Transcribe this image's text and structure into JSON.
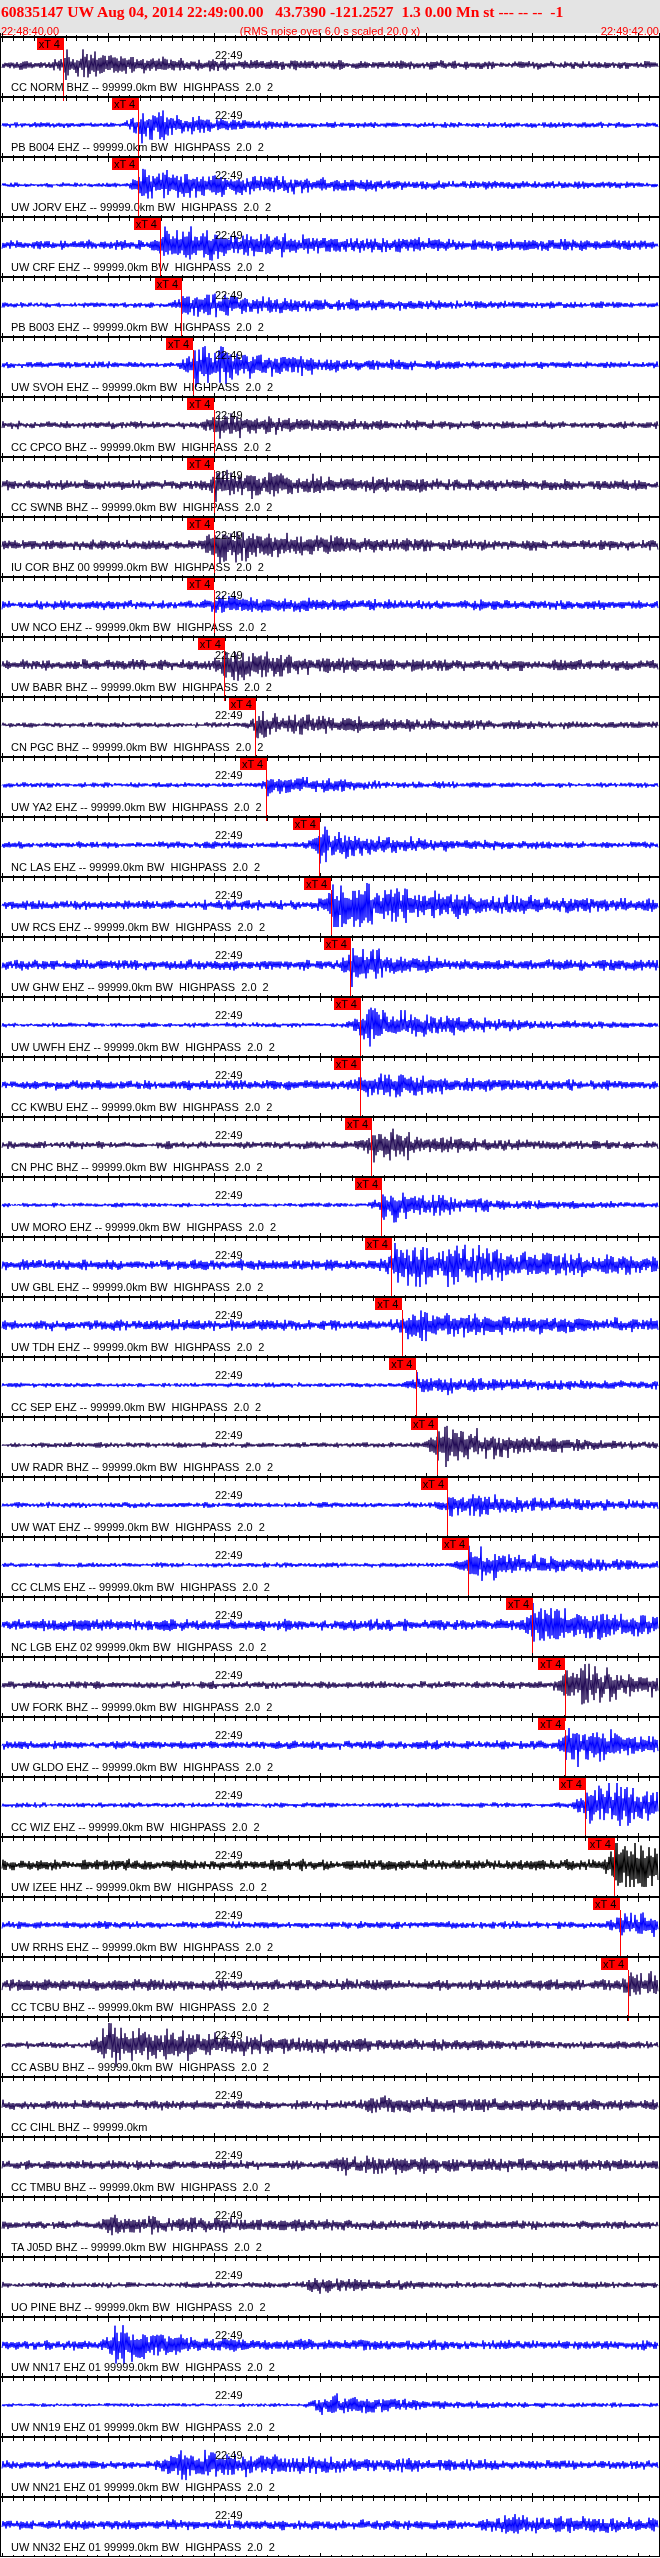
{
  "header": {
    "title": "60835147 UW Aug 04, 2014 22:49:00.00   43.7390 -121.2527  1.3 0.00 Mn st --- -- --  -1",
    "start_time": "22:48:40.00",
    "note": "(RMS noise over 6.0 s scaled 20.0 x)",
    "end_time": "22:49:42.00"
  },
  "traces": [
    {
      "label": "CC NORM BHZ -- 99999.0km BW  HIGHPASS  2.0  2",
      "time_label": "22:49",
      "color": "#220b55",
      "pick": {
        "label": "xT 4",
        "level": 0.095
      }
    },
    {
      "label": "PB B004 EHZ -- 99999.0km BW  HIGHPASS  2.0  2",
      "time_label": "22:49",
      "color": "#0000ff",
      "pick": {
        "label": "xT 4",
        "level": 0.209
      }
    },
    {
      "label": "UW JORV EHZ -- 99999.0km BW  HIGHPASS  2.0  2",
      "time_label": "22:49",
      "color": "#0000ff",
      "pick": {
        "label": "xT 4",
        "level": 0.209
      }
    },
    {
      "label": "UW CRF EHZ -- 99999.0km BW  HIGHPASS  2.0  2",
      "time_label": "22:49",
      "color": "#0000ff",
      "pick": {
        "label": "xT 4",
        "level": 0.242
      }
    },
    {
      "label": "PB B003 EHZ -- 99999.0km BW  HIGHPASS  2.0  2",
      "time_label": "22:49",
      "color": "#0000ff",
      "pick": {
        "label": "xT 4",
        "level": 0.274
      }
    },
    {
      "label": "UW SVOH EHZ -- 99999.0km BW  HIGHPASS  2.0  2",
      "time_label": "22:49",
      "color": "#0000ff",
      "pick": {
        "label": "xT 4",
        "level": 0.291
      }
    },
    {
      "label": "CC CPCO BHZ -- 99999.0km BW  HIGHPASS  2.0  2",
      "time_label": "22:49",
      "color": "#220b55",
      "pick": {
        "label": "xT 4",
        "level": 0.323
      }
    },
    {
      "label": "CC SWNB BHZ -- 99999.0km BW  HIGHPASS  2.0  2",
      "time_label": "22:49",
      "color": "#220b55",
      "pick": {
        "label": "xT 4",
        "level": 0.323
      }
    },
    {
      "label": "IU COR BHZ 00 99999.0km BW  HIGHPASS  2.0  2",
      "time_label": "22:49",
      "color": "#220b55",
      "pick": {
        "label": "xT 4",
        "level": 0.323
      }
    },
    {
      "label": "UW NCO EHZ -- 99999.0km BW  HIGHPASS  2.0  2",
      "time_label": "22:49",
      "color": "#0000ff",
      "pick": {
        "label": "xT 4",
        "level": 0.323
      }
    },
    {
      "label": "UW BABR BHZ -- 99999.0km BW  HIGHPASS  2.0  2",
      "time_label": "22:49",
      "color": "#220b55",
      "pick": {
        "label": "xT 4",
        "level": 0.339
      }
    },
    {
      "label": "CN PGC BHZ -- 99999.0km BW  HIGHPASS  2.0  2",
      "time_label": "22:49",
      "color": "#220b55",
      "pick": {
        "label": "xT 4",
        "level": 0.386
      }
    },
    {
      "label": "UW YA2 EHZ -- 99999.0km BW  HIGHPASS  2.0  2",
      "time_label": "22:49",
      "color": "#0000ff",
      "pick": {
        "label": "xT 4",
        "level": 0.403
      }
    },
    {
      "label": "NC LAS EHZ -- 99999.0km BW  HIGHPASS  2.0  2",
      "time_label": "22:49",
      "color": "#0000ff",
      "pick": {
        "label": "xT 4",
        "level": 0.483
      }
    },
    {
      "label": "UW RCS EHZ -- 99999.0km BW  HIGHPASS  2.0  2",
      "time_label": "22:49",
      "color": "#0000ff",
      "pick": {
        "label": "xT 4",
        "level": 0.5
      }
    },
    {
      "label": "UW GHW EHZ -- 99999.0km BW  HIGHPASS  2.0  2",
      "time_label": "22:49",
      "color": "#0000ff",
      "pick": {
        "label": "xT 4",
        "level": 0.53
      }
    },
    {
      "label": "UW UWFH EHZ -- 99999.0km BW  HIGHPASS  2.0  2",
      "time_label": "22:49",
      "color": "#0000ff",
      "pick": {
        "label": "xT 4",
        "level": 0.545
      }
    },
    {
      "label": "CC KWBU EHZ -- 99999.0km BW  HIGHPASS  2.0  2",
      "time_label": "22:49",
      "color": "#0000ff",
      "pick": {
        "label": "xT 4",
        "level": 0.545
      }
    },
    {
      "label": "CN PHC BHZ -- 99999.0km BW  HIGHPASS  2.0  2",
      "time_label": "22:49",
      "color": "#220b55",
      "pick": {
        "label": "xT 4",
        "level": 0.562
      }
    },
    {
      "label": "UW MORO EHZ -- 99999.0km BW  HIGHPASS  2.0  2",
      "time_label": "22:49",
      "color": "#0000ff",
      "pick": {
        "label": "xT 4",
        "level": 0.577
      }
    },
    {
      "label": "UW GBL EHZ -- 99999.0km BW  HIGHPASS  2.0  2",
      "time_label": "22:49",
      "color": "#0000ff",
      "pick": {
        "label": "xT 4",
        "level": 0.592
      }
    },
    {
      "label": "UW TDH EHZ -- 99999.0km BW  HIGHPASS  2.0  2",
      "time_label": "22:49",
      "color": "#0000ff",
      "pick": {
        "label": "xT 4",
        "level": 0.608
      }
    },
    {
      "label": "CC SEP EHZ -- 99999.0km BW  HIGHPASS  2.0  2",
      "time_label": "22:49",
      "color": "#0000ff",
      "pick": {
        "label": "xT 4",
        "level": 0.629
      }
    },
    {
      "label": "UW RADR BHZ -- 99999.0km BW  HIGHPASS  2.0  2",
      "time_label": "22:49",
      "color": "#220b55",
      "pick": {
        "label": "xT 4",
        "level": 0.662
      }
    },
    {
      "label": "UW WAT EHZ -- 99999.0km BW  HIGHPASS  2.0  2",
      "time_label": "22:49",
      "color": "#0000ff",
      "pick": {
        "label": "xT 4",
        "level": 0.677
      }
    },
    {
      "label": "CC CLMS EHZ -- 99999.0km BW  HIGHPASS  2.0  2",
      "time_label": "22:49",
      "color": "#0000ff",
      "pick": {
        "label": "xT 4",
        "level": 0.709
      }
    },
    {
      "label": "NC LGB EHZ 02 99999.0km BW  HIGHPASS  2.0  2",
      "time_label": "22:49",
      "color": "#0000ff",
      "pick": {
        "label": "xT 4",
        "level": 0.806
      }
    },
    {
      "label": "UW FORK BHZ -- 99999.0km BW  HIGHPASS  2.0  2",
      "time_label": "22:49",
      "color": "#220b55",
      "pick": {
        "label": "xT 4",
        "level": 0.855
      }
    },
    {
      "label": "UW GLDO EHZ -- 99999.0km BW  HIGHPASS  2.0  2",
      "time_label": "22:49",
      "color": "#0000ff",
      "pick": {
        "label": "xT 4",
        "level": 0.855
      }
    },
    {
      "label": "CC WIZ EHZ -- 99999.0km BW  HIGHPASS  2.0  2",
      "time_label": "22:49",
      "color": "#0000ff",
      "pick": {
        "label": "xT 4",
        "level": 0.886
      }
    },
    {
      "label": "UW IZEE HHZ -- 99999.0km BW  HIGHPASS  2.0  2",
      "time_label": "22:49",
      "color": "#000000",
      "pick": {
        "label": "xT 4",
        "level": 0.93
      }
    },
    {
      "label": "UW RRHS EHZ -- 99999.0km BW  HIGHPASS  2.0  2",
      "time_label": "22:49",
      "color": "#0000ff",
      "pick": {
        "label": "xT 4",
        "level": 0.938
      }
    },
    {
      "label": "CC TCBU BHZ -- 99999.0km BW  HIGHPASS  2.0  2",
      "time_label": "22:49",
      "color": "#220b55",
      "pick": {
        "label": "xT 4",
        "level": 0.95
      }
    },
    {
      "label": "CC ASBU BHZ -- 99999.0km BW  HIGHPASS  2.0  2",
      "time_label": "22:49",
      "color": "#220b55"
    },
    {
      "label": "CC CIHL BHZ -- 99999.0km",
      "time_label": "22:49",
      "color": "#220b55"
    },
    {
      "label": "CC TMBU BHZ -- 99999.0km BW  HIGHPASS  2.0  2",
      "time_label": "22:49",
      "color": "#220b55"
    },
    {
      "label": "TA J05D BHZ -- 99999.0km BW  HIGHPASS  2.0  2",
      "time_label": "22:49",
      "color": "#220b55"
    },
    {
      "label": "UO PINE BHZ -- 99999.0km BW  HIGHPASS  2.0  2",
      "time_label": "22:49",
      "color": "#220b55"
    },
    {
      "label": "UW NN17 EHZ 01 99999.0km BW  HIGHPASS  2.0  2",
      "time_label": "22:49",
      "color": "#0000ff"
    },
    {
      "label": "UW NN19 EHZ 01 99999.0km BW  HIGHPASS  2.0  2",
      "time_label": "22:49",
      "color": "#0000ff"
    },
    {
      "label": "UW NN21 EHZ 01 99999.0km BW  HIGHPASS  2.0  2",
      "time_label": "22:49",
      "color": "#0000ff"
    },
    {
      "label": "UW NN32 EHZ 01 99999.0km BW  HIGHPASS  2.0  2",
      "time_label": "22:49",
      "color": "#0000ff"
    }
  ]
}
